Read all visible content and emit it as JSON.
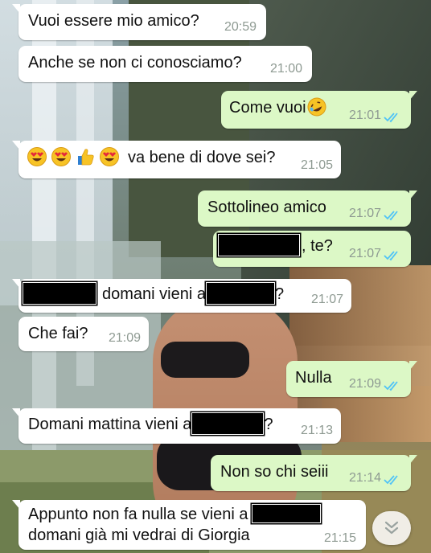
{
  "messages": [
    {
      "direction": "incoming",
      "text": "Vuoi essere mio amico?",
      "time": "20:59"
    },
    {
      "direction": "incoming",
      "text": "Anche se non ci conosciamo?",
      "time": "21:00"
    },
    {
      "direction": "outgoing",
      "text": "Come vuoi",
      "emoji": "rofl-emoji",
      "time": "21:01",
      "status": "read"
    },
    {
      "direction": "incoming",
      "emojis": [
        "heart-eyes-emoji",
        "heart-eyes-emoji",
        "thumbs-up-emoji",
        "heart-eyes-emoji"
      ],
      "text": "va bene di dove sei?",
      "time": "21:05"
    },
    {
      "direction": "outgoing",
      "text": "Sottolineo amico",
      "time": "21:07",
      "status": "read"
    },
    {
      "direction": "outgoing",
      "text": ", te?",
      "time": "21:07",
      "status": "read",
      "redacted_prefix": true
    },
    {
      "direction": "incoming",
      "text_a": "domani vieni a",
      "text_b": "?",
      "time": "21:07",
      "redacted": true
    },
    {
      "direction": "incoming",
      "text": "Che fai?",
      "time": "21:09"
    },
    {
      "direction": "outgoing",
      "text": "Nulla",
      "time": "21:09",
      "status": "read"
    },
    {
      "direction": "incoming",
      "text_a": "Domani mattina vieni a",
      "text_b": "?",
      "time": "21:13",
      "redacted": true
    },
    {
      "direction": "outgoing",
      "text": "Non so chi seiii",
      "time": "21:14",
      "status": "read"
    },
    {
      "direction": "incoming",
      "line1": "Appunto non fa nulla se vieni a",
      "line2": "domani già mi vedrai di Giorgia",
      "time": "21:15",
      "redacted": true
    }
  ],
  "colors": {
    "incoming_bubble": "#ffffff",
    "outgoing_bubble": "#dcf8c6",
    "read_ticks": "#4fc3f7",
    "timestamp": "#8e9a92"
  },
  "controls": {
    "scroll_down_icon": "double-chevron-down-icon"
  }
}
